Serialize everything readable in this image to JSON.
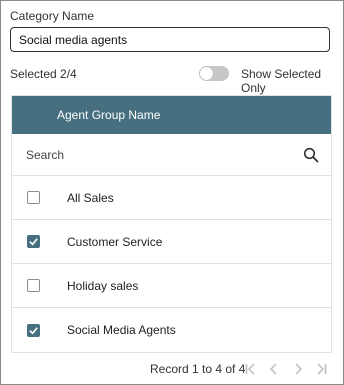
{
  "form": {
    "category_label": "Category Name",
    "category_value": "Social media agents",
    "selected_text": "Selected 2/4",
    "show_selected_label": "Show Selected Only",
    "show_selected_on": false
  },
  "table": {
    "header": "Agent Group Name",
    "search_placeholder": "Search",
    "rows": [
      {
        "name": "All Sales",
        "checked": false
      },
      {
        "name": "Customer Service",
        "checked": true
      },
      {
        "name": "Holiday sales",
        "checked": false
      },
      {
        "name": "Social Media Agents",
        "checked": true
      }
    ]
  },
  "pagination": {
    "record_text": "Record 1 to 4 of 4"
  },
  "colors": {
    "header_bg": "#466f7f",
    "checkbox_checked": "#466f7f"
  }
}
